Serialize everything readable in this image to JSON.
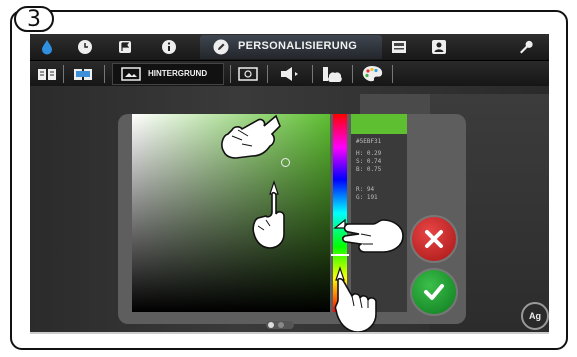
{
  "step": "3",
  "topbar": {
    "active_tab": "PERSONALISIERUNG",
    "icons": [
      "drop-icon",
      "clock-icon",
      "flag-icon",
      "info-icon",
      "pencil-icon",
      "image-icon",
      "user-icon",
      "wrench-icon"
    ]
  },
  "subbar": {
    "active_tab": "HINTERGRUND",
    "icons": [
      "book-icon",
      "map-book-icon",
      "picture-icon",
      "picture-settings-icon",
      "speaker-icon",
      "weather-icon",
      "palette-icon"
    ]
  },
  "color_picker": {
    "hex": "#5EBF31",
    "h": "H: 0.29",
    "s": "S: 0.74",
    "b": "B: 0.75",
    "r": "R: 94",
    "g": "G: 191",
    "selected_color": "#5ebf31"
  },
  "buttons": {
    "cancel": "cancel",
    "confirm": "confirm"
  }
}
